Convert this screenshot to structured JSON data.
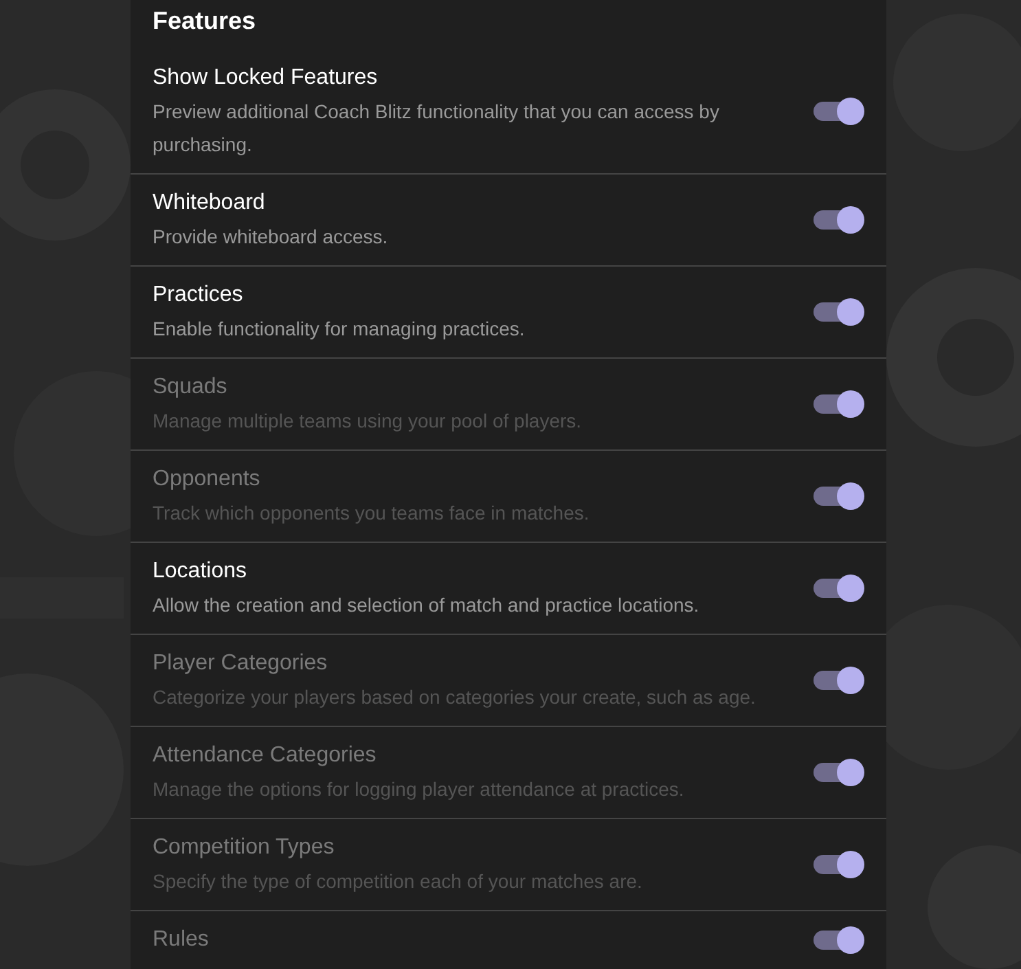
{
  "section_title": "Features",
  "features": [
    {
      "title": "Show Locked Features",
      "description": "Preview additional Coach Blitz functionality that you can access by purchasing.",
      "on": true,
      "disabled": false
    },
    {
      "title": "Whiteboard",
      "description": "Provide whiteboard access.",
      "on": true,
      "disabled": false
    },
    {
      "title": "Practices",
      "description": "Enable functionality for managing practices.",
      "on": true,
      "disabled": false
    },
    {
      "title": "Squads",
      "description": "Manage multiple teams using your pool of players.",
      "on": true,
      "disabled": true
    },
    {
      "title": "Opponents",
      "description": "Track which opponents you teams face in matches.",
      "on": true,
      "disabled": true
    },
    {
      "title": "Locations",
      "description": "Allow the creation and selection of match and practice locations.",
      "on": true,
      "disabled": false
    },
    {
      "title": "Player Categories",
      "description": "Categorize your players based on categories your create, such as age.",
      "on": true,
      "disabled": true
    },
    {
      "title": "Attendance Categories",
      "description": "Manage the options for logging player attendance at practices.",
      "on": true,
      "disabled": true
    },
    {
      "title": "Competition Types",
      "description": "Specify the type of competition each of your matches are.",
      "on": true,
      "disabled": true
    },
    {
      "title": "Rules",
      "on": true,
      "disabled": true
    }
  ]
}
